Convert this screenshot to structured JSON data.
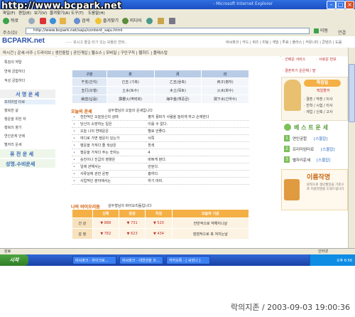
{
  "overlay_url": "http://www.bcpark.net",
  "window": {
    "title": "- Microsoft Internet Explorer"
  },
  "menubar": [
    "파일(F)",
    "편집(E)",
    "보기(V)",
    "즐겨찾기(A)",
    "도구(T)",
    "도움말(H)"
  ],
  "toolbar": {
    "back": "뒤로",
    "search": "검색",
    "favorites": "즐겨찾기",
    "media": "미디어"
  },
  "address": {
    "label": "주소(D)",
    "value": "http://www.bcpark.net/saju/content_saju.html",
    "go": "이동",
    "links": "연결"
  },
  "site": {
    "logo": "BCPARK.net",
    "slogan": "······ 보시고 즐길 타기 있는 보물은 연락..",
    "top_links": "비씨파크 | 카드 | 퀴즈 | 미팅 | 게임 | 투표 | 플러스 | 커뮤니티 | 콘텐츠 | 도움",
    "nav": "마시건 | 운세·사주 | 드라이브 | 생인튠탑 | 공인개입 | 웹소스 | 모바일 | 구인구직 | 웹하드 | 플래스탑"
  },
  "sidebar": {
    "items_top": [
      "특징의 약탈",
      "연애 궁합하다",
      "적성 궁합하다"
    ],
    "title": "서 명 운 세",
    "items": [
      "프리미엄 타로",
      "행복한 삶",
      "행운을 위한 자",
      "행복의 향기",
      "연인관계 안에",
      "별자리 운세"
    ],
    "section1": "퓨 전 운 세",
    "section2": "성명.수비운세"
  },
  "zodiac": {
    "headers": [
      "구분",
      "年",
      "月",
      "日"
    ],
    "rows": [
      [
        "干支(간지)",
        "己丑 (기축)",
        "乙丑(을축)",
        "丙子(병자)"
      ],
      [
        "五行(오행)",
        "土水(토수)",
        "木土(목토)",
        "火水(화수)"
      ],
      [
        "納音(납음)",
        "霹靂火(벽력화)",
        "海中金(해중금)",
        "澗下水(간하수)"
      ]
    ]
  },
  "fortune": {
    "title": "오늘의 운세",
    "subtitle": "김두형님의 오늘의 운세입니다",
    "rows": [
      [
        "전반적인 오늘당신의 상태",
        "평지 풍파가 사람을 놀라게 하고 손재한다"
      ],
      [
        "당신이 소망하는 일은",
        "이룰 수 없다."
      ],
      [
        "오늘 나의 연애운은",
        "별로 안좋다."
      ],
      [
        "여디로 가면 행운이 있는가",
        "서쪽"
      ],
      [
        "행운을 가져다 줄 색상은",
        "흰색"
      ],
      [
        "행운을 가져다 주는 숫자는",
        "4"
      ],
      [
        "승진이나 진급의 영향은",
        "바쁘게 뛴다."
      ],
      [
        "일에 관해서는",
        "안된다."
      ],
      [
        "사류상에 관한 운명",
        "흉하다."
      ],
      [
        "사업적인 분야에서는",
        "하기 마라."
      ]
    ]
  },
  "bio": {
    "title": "나의 바이오리듬",
    "subtitle": "김두형님의 바이오리듬입니다",
    "headers": [
      "",
      "신체",
      "감성",
      "지성",
      "오늘의 기운"
    ],
    "rows": [
      [
        "건 강",
        "▼ 888",
        "▼ 731",
        "▼ 520",
        "전반적으로 약해지니날"
      ],
      [
        "감 정",
        "▼ 782",
        "▼ 623",
        "▼ 434",
        "점점적으로 축 쳐지는날"
      ]
    ]
  },
  "right": {
    "top_links": [
      "· 선배운 서비스",
      "· 사랑운 반보",
      "· 결혼하기 운은해 / 말"
    ],
    "banner_title": "특징일",
    "banner_sub": "택일할까",
    "banner_lines": [
      "· 결혼 / 약혼 / 이사",
      "· 진학 / 시험 / 이사",
      "· 개업 / 신축 / 고사"
    ],
    "best_title": "베 스 트 운 세",
    "best_items": [
      {
        "num": "1",
        "label": "연인궁합",
        "action": "[스물잡]"
      },
      {
        "num": "2",
        "label": "프리미엄타로",
        "action": "[스물잡]"
      },
      {
        "num": "3",
        "label": "별자리운세",
        "action": "[스물잡]"
      }
    ],
    "name_title": "이름작명",
    "name_desc": "원칙으로 생년월일을 기준으로 이름작명을 도와드립니다"
  },
  "statusbar": {
    "left": "완료",
    "right": "인터넷"
  },
  "taskbar": {
    "start": "시작",
    "tasks": [
      "비씨파크 - 마이크로...",
      "비씨파크 - 대연관을 조...",
      "카카오톡 - [ 씨앗나 ]"
    ],
    "clock": "오후 6:56"
  },
  "caption": "락의지존 / 2003-09-03 19:00:36",
  "colors": {
    "accent": "#2f6fe0",
    "orange": "#f5b045",
    "blue_header": "#b8cce6"
  }
}
